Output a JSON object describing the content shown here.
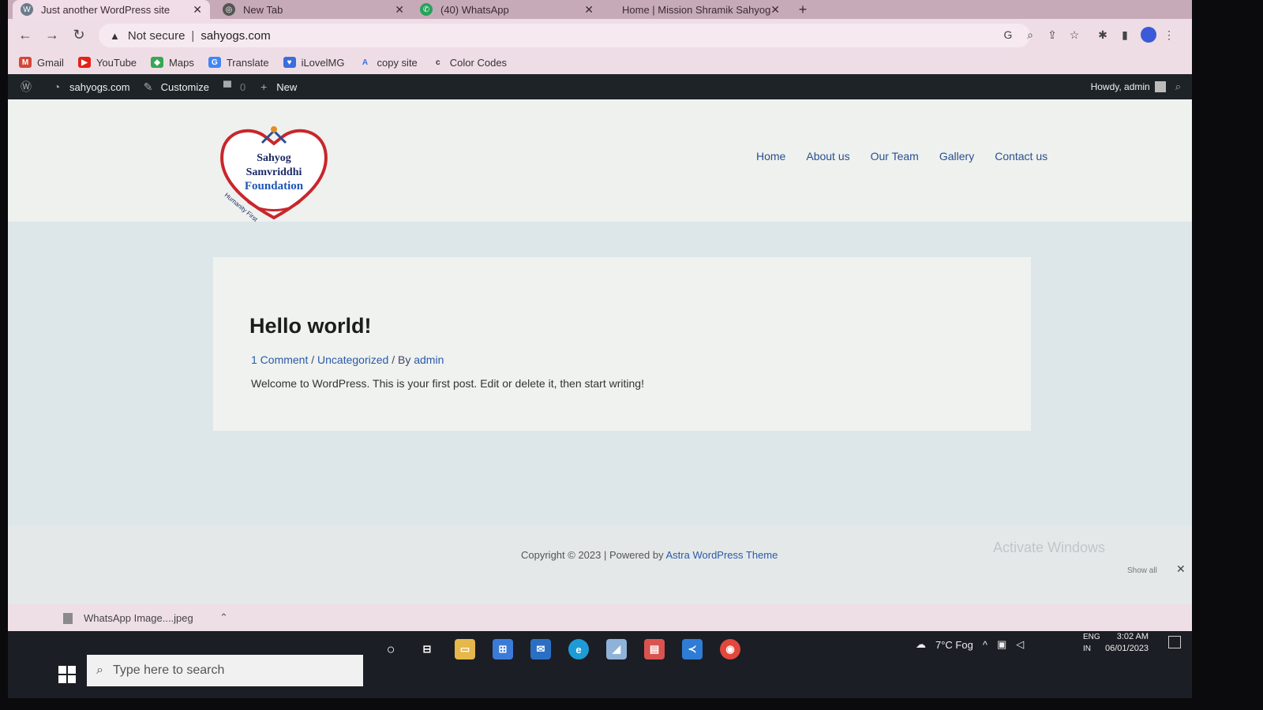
{
  "browser": {
    "tabs": [
      {
        "title": "Just another WordPress site",
        "active": true
      },
      {
        "title": "New Tab",
        "active": false
      },
      {
        "title": "(40) WhatsApp",
        "active": false
      },
      {
        "title": "Home | Mission Shramik Sahyog",
        "active": false
      }
    ],
    "security_label": "Not secure",
    "url": "sahyogs.com",
    "bookmarks": [
      "Gmail",
      "YouTube",
      "Maps",
      "Translate",
      "iLovelMG",
      "copy site",
      "Color Codes"
    ]
  },
  "adminbar": {
    "site_name": "sahyogs.com",
    "customize": "Customize",
    "comments_count": "0",
    "new_label": "New",
    "howdy": "Howdy, admin"
  },
  "site": {
    "logo": {
      "line1": "Sahyog",
      "line2": "Samvriddhi",
      "line3": "Foundation",
      "tagline": "Humanity First"
    },
    "nav": [
      "Home",
      "About us",
      "Our Team",
      "Gallery",
      "Contact us"
    ],
    "post": {
      "title": "Hello world!",
      "comments": "1 Comment",
      "sep1": " / ",
      "category": "Uncategorized",
      "by": " / By ",
      "author": "admin",
      "excerpt": "Welcome to WordPress. This is your first post. Edit or delete it, then start writing!"
    },
    "footer": {
      "copyright": "Copyright © 2023 | Powered by ",
      "theme_link": "Astra WordPress Theme"
    }
  },
  "windows": {
    "activate": "Activate Windows",
    "show_all": "Show all",
    "download": "WhatsApp Image....jpeg",
    "search_placeholder": "Type here to search",
    "weather": "7°C Fog",
    "lang1": "ENG",
    "lang2": "IN",
    "time": "3:02 AM",
    "date": "06/01/2023"
  },
  "colors": {
    "wp_admin_bar": "#1d2327",
    "link": "#2a5aa8",
    "tab_strip": "#c7aab8"
  }
}
